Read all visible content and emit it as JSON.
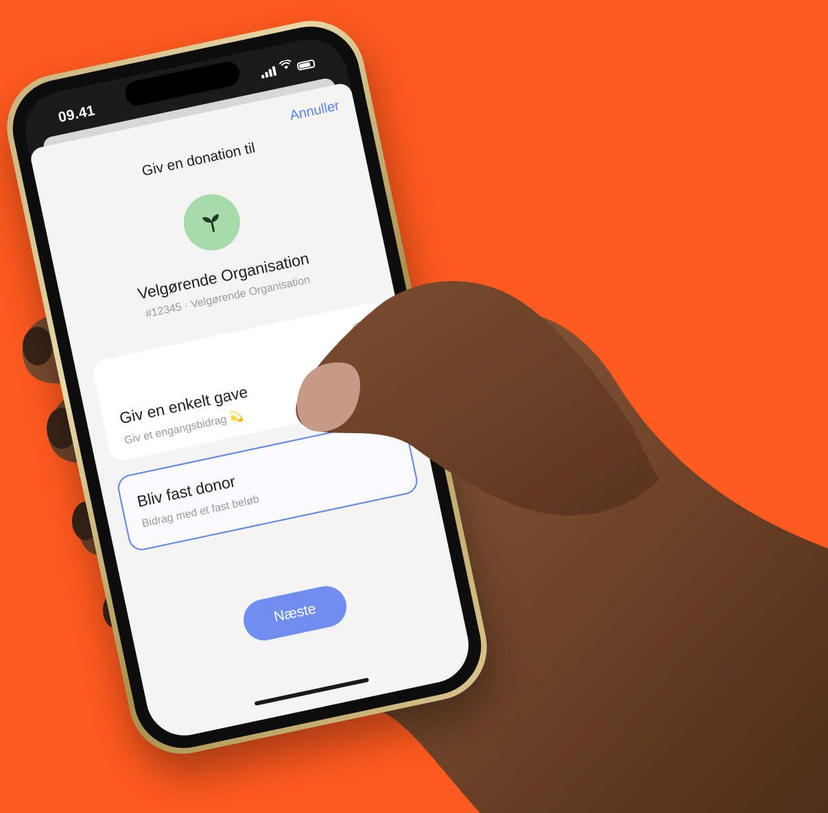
{
  "status_bar": {
    "time": "09.41"
  },
  "sheet": {
    "cancel_label": "Annuller",
    "title": "Giv en donation til"
  },
  "organization": {
    "name": "Velgørende Organisation",
    "subtitle": "#12345 · Velgørende Organisation",
    "avatar_icon": "sprout-icon",
    "avatar_color": "#a8dbab"
  },
  "options": {
    "single": {
      "title": "Giv en enkelt gave",
      "subtitle": "Giv et engangsbidrag 💫"
    },
    "recurring": {
      "title": "Bliv fast donor",
      "subtitle": "Bidrag med et fast beløb"
    }
  },
  "next_label": "Næste",
  "colors": {
    "background": "#FF5A1F",
    "accent": "#5b82f0",
    "button": "#6f8ef0"
  }
}
